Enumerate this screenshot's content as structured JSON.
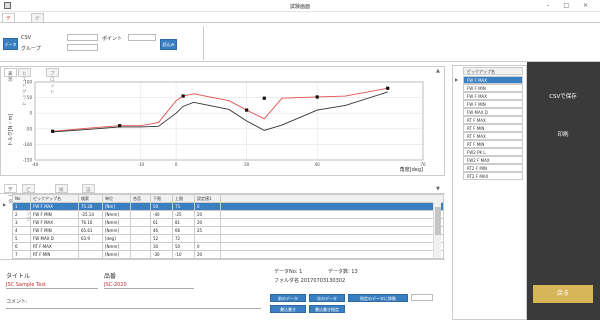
{
  "window": {
    "title": "試験画面",
    "controls": "– □ ×"
  },
  "tabs": [
    "データ読込み",
    "グラフ設定"
  ],
  "topbar": {
    "left_button": "データ選択",
    "label_csv": "CSV",
    "label_group": "グループ",
    "label_point": "ポイント",
    "load_button": "読込み"
  },
  "chart_tabs": [
    "表示",
    "ヒストグラム",
    "プロット"
  ],
  "chart_data": {
    "type": "line",
    "ylabel": "トルク[N・m]",
    "xlabel": "角度[deg]",
    "x_ticks": [
      "-40",
      "-10",
      "0",
      "20",
      "40",
      "70"
    ],
    "y_ticks": [
      "100",
      "50",
      "0",
      "-50",
      "-100",
      "-150"
    ],
    "xlim": [
      -40,
      70
    ],
    "ylim": [
      -150,
      100
    ],
    "series": [
      {
        "color": "#e05050",
        "x": [
          -35,
          -25,
          -16,
          -10,
          -5,
          0,
          2,
          5,
          15,
          20,
          25,
          30,
          40,
          48,
          60
        ],
        "y": [
          -58,
          -48,
          -40,
          -40,
          -30,
          40,
          55,
          62,
          40,
          10,
          -18,
          48,
          52,
          55,
          80
        ]
      },
      {
        "color": "#333333",
        "x": [
          -35,
          -25,
          -16,
          -10,
          -5,
          0,
          2,
          5,
          15,
          20,
          25,
          30,
          40,
          48,
          60
        ],
        "y": [
          -60,
          -52,
          -44,
          -44,
          -42,
          0,
          22,
          35,
          12,
          -25,
          -55,
          -38,
          10,
          25,
          68
        ]
      }
    ],
    "markers": [
      {
        "x": -35,
        "y": -58
      },
      {
        "x": -16,
        "y": -40
      },
      {
        "x": 2,
        "y": 55
      },
      {
        "x": 20,
        "y": 10
      },
      {
        "x": 25,
        "y": 48
      },
      {
        "x": 40,
        "y": 52
      },
      {
        "x": 60,
        "y": 80
      }
    ]
  },
  "bottom_tabs": [
    "データ",
    "ピックアップ",
    "検索一覧",
    "設定"
  ],
  "table": {
    "headers": [
      "No",
      "ピックアップ名",
      "検索",
      "単位",
      "合否",
      "下限",
      "上限",
      "設定値1"
    ],
    "rows": [
      [
        "1",
        "FW F MAX",
        "75.28",
        "[Nm]",
        "",
        "50",
        "75",
        "0"
      ],
      [
        "2",
        "FW F MIN",
        "-25.14",
        "[Nmm]",
        "",
        "-40",
        "-25",
        "20"
      ],
      [
        "3",
        "FW F MAX",
        "76.16",
        "[Nmm]",
        "",
        "61",
        "81",
        "20"
      ],
      [
        "4",
        "FW F MIN",
        "65.61",
        "[Nmm]",
        "",
        "46",
        "66",
        "25"
      ],
      [
        "5",
        "FW MAX D",
        "63.9",
        "[deg]",
        "",
        "52",
        "72",
        ""
      ],
      [
        "6",
        "RT F MAX",
        "",
        "[Nmm]",
        "",
        "30",
        "50",
        "0"
      ],
      [
        "7",
        "RT F MIN",
        "",
        "[Nmm]",
        "",
        "-30",
        "-10",
        "20"
      ]
    ]
  },
  "footer": {
    "title_label": "タイトル",
    "title_value": "JSC Sample Test",
    "product_label": "品番",
    "product_value": "JSC-2020",
    "comment_label": "コメント:",
    "data_no_label": "データNo: 1",
    "data_count_label": "データ数: 13",
    "folder_label": "フォルダ名 20170703130302",
    "btn_prev": "前のデータ",
    "btn_next": "次のデータ",
    "btn_jump": "指定のデータに移動",
    "btn_save": "書込書き",
    "btn_save2": "書込書き指定"
  },
  "right_list": {
    "header": "ピックアップ名",
    "items": [
      "FW F MAX",
      "FW F MIN",
      "FW F MAX",
      "FW F MIN",
      "FW MAX D",
      "RT F MAX",
      "RT F MIN",
      "RT F MAX",
      "RT F MIN",
      "FW2 PK L",
      "FW2 F MAX",
      "RT2 F MIN",
      "RT2 F MAX"
    ]
  },
  "side_buttons": {
    "csv_save": "CSVで保存",
    "print": "印刷",
    "back": "戻る"
  },
  "colors": {
    "accent": "#3a7fc1",
    "dark_panel": "#3a3a3a",
    "return": "#d7b65a",
    "red_series": "#e05050",
    "black_series": "#333333"
  }
}
